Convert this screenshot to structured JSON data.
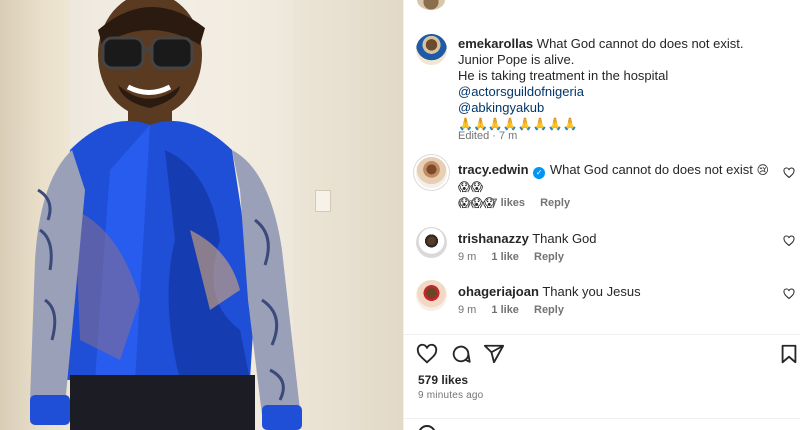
{
  "post": {
    "caption_user": "emekarollas",
    "caption_lines": [
      "What God cannot do does not exist.",
      "Junior Pope is alive.",
      "He is taking treatment in the hospital"
    ],
    "mentions": [
      "@actorsguildofnigeria",
      "@abkingyakub"
    ],
    "caption_emoji": "🙏🙏🙏🙏🙏🙏🙏🙏",
    "caption_meta": "Edited · 7 m"
  },
  "comments": [
    {
      "user": "tracy.edwin",
      "verified": true,
      "text": "What God cannot do does not exist",
      "emoji_a": "😢😱😱",
      "emoji_b": "😱😱😱",
      "time": "6 m",
      "likes": "7 likes",
      "reply": "Reply"
    },
    {
      "user": "trishanazzy",
      "text": "Thank God",
      "time": "9 m",
      "likes": "1 like",
      "reply": "Reply"
    },
    {
      "user": "ohageriajoan",
      "text": "Thank you Jesus",
      "time": "9 m",
      "likes": "1 like",
      "reply": "Reply"
    }
  ],
  "engagement": {
    "likes": "579 likes",
    "posted": "9 minutes ago"
  },
  "icons": {
    "like": "heart-icon",
    "comment": "comment-icon",
    "share": "share-icon",
    "save": "bookmark-icon",
    "comment_like": "heart-icon",
    "composer": "emoji-icon"
  },
  "colors": {
    "link": "#00376b",
    "verified": "#0095f6",
    "muted": "#737373",
    "shirt_blue": "#1e4fd6"
  }
}
